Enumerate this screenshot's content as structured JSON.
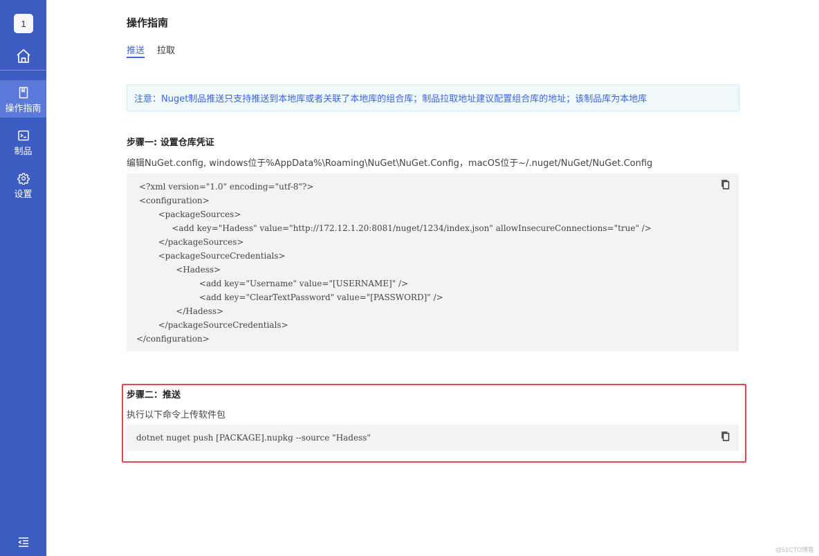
{
  "sidebar": {
    "badge": "1",
    "items": [
      {
        "label": "操作指南",
        "icon": "book-icon",
        "active": true
      },
      {
        "label": "制品",
        "icon": "terminal-icon",
        "active": false
      },
      {
        "label": "设置",
        "icon": "gear-icon",
        "active": false
      }
    ],
    "accent_color": "#3c5cc4",
    "active_color": "#5a79d8"
  },
  "main": {
    "title": "操作指南",
    "tabs": [
      {
        "label": "推送",
        "active": true
      },
      {
        "label": "拉取",
        "active": false
      }
    ],
    "notice": "注意：Nuget制品推送只支持推送到本地库或者关联了本地库的组合库；制品拉取地址建议配置组合库的地址；该制品库为本地库",
    "step1": {
      "title": "步骤一: 设置仓库凭证",
      "description": "编辑NuGet.config, windows位于%AppData%\\Roaming\\NuGet\\NuGet.Config，macOS位于~/.nuget/NuGet/NuGet.Config",
      "code_lines": [
        "<?xml version=\"1.0\" encoding=\"utf-8\"?>",
        "<configuration>",
        "  <packageSources>",
        "    <add key=\"Hadess\" value=\"http://172.12.1.20:8081/nuget/1234/index.json\" allowInsecureConnections=\"true\" />",
        "  </packageSources>",
        "  <packageSourceCredentials>",
        "    <Hadess>",
        "      <add key=\"Username\" value=\"[USERNAME]\" />",
        "      <add key=\"ClearTextPassword\" value=\"[PASSWORD]\" />",
        "    </Hadess>",
        "  </packageSourceCredentials>",
        "</configuration>"
      ]
    },
    "step2": {
      "title": "步骤二：推送",
      "description": "执行以下命令上传软件包",
      "code": "dotnet nuget push [PACKAGE].nupkg --source \"Hadess\""
    }
  },
  "watermark": "@51CTO博客",
  "colors": {
    "link": "#3d63e0",
    "highlight_border": "#e3464d",
    "code_bg": "#f3f3f4"
  }
}
